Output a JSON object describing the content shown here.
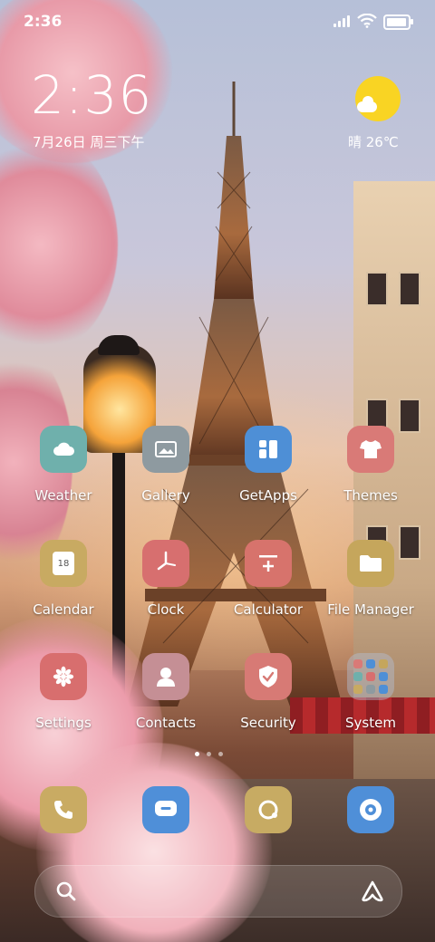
{
  "status_bar": {
    "time": "2:36"
  },
  "clock_widget": {
    "time": "2:36",
    "date": "7月26日 周三下午"
  },
  "weather_widget": {
    "text": "晴 26℃"
  },
  "apps": [
    {
      "label": "Weather",
      "color": "#6fb0ac",
      "icon": "cloud-icon"
    },
    {
      "label": "Gallery",
      "color": "#8e9aa0",
      "icon": "image-icon"
    },
    {
      "label": "GetApps",
      "color": "#4e8fd6",
      "icon": "getapps-icon"
    },
    {
      "label": "Themes",
      "color": "#d97a77",
      "icon": "tshirt-icon"
    },
    {
      "label": "Calendar",
      "color": "#c8aa62",
      "icon": "calendar-icon",
      "badge": "18"
    },
    {
      "label": "Clock",
      "color": "#d76f6f",
      "icon": "clock-icon"
    },
    {
      "label": "Calculator",
      "color": "#d7736c",
      "icon": "calculator-icon"
    },
    {
      "label": "File Manager",
      "color": "#c5a65c",
      "icon": "folder-icon"
    },
    {
      "label": "Settings",
      "color": "#d86e6e",
      "icon": "gear-icon"
    },
    {
      "label": "Contacts",
      "color": "#c58f95",
      "icon": "person-icon"
    },
    {
      "label": "Security",
      "color": "#d77a75",
      "icon": "shield-icon"
    },
    {
      "label": "System",
      "color": "#7a8ca8",
      "icon": "folder-grid-icon"
    }
  ],
  "dock": [
    {
      "name": "phone",
      "color": "#c9ab63",
      "icon": "phone-icon"
    },
    {
      "name": "messages",
      "color": "#4f8fd8",
      "icon": "message-icon"
    },
    {
      "name": "browser",
      "color": "#c7ab63",
      "icon": "browser-icon"
    },
    {
      "name": "camera",
      "color": "#4f8fd8",
      "icon": "camera-icon"
    }
  ]
}
